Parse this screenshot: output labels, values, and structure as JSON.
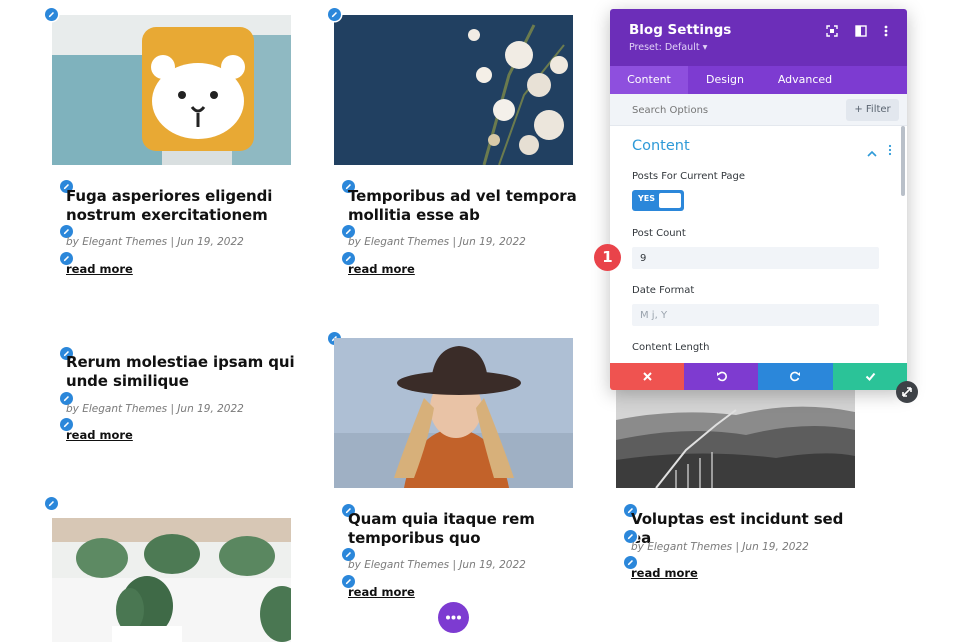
{
  "posts": [
    {
      "title": "Fuga asperiores eligendi nostrum exercitationem",
      "meta": "by Elegant Themes | Jun 19, 2022",
      "read_more": "read more"
    },
    {
      "title": "Temporibus ad vel tempora mollitia esse ab",
      "meta": "by Elegant Themes | Jun 19, 2022",
      "read_more": "read more"
    },
    {
      "title": "Rerum molestiae ipsam qui unde similique",
      "meta": "by Elegant Themes | Jun 19, 2022",
      "read_more": "read more"
    },
    {
      "title": "Quam quia itaque rem temporibus quo",
      "meta": "by Elegant Themes | Jun 19, 2022",
      "read_more": "read more"
    },
    {
      "title": "Voluptas est incidunt sed ea",
      "meta": "by Elegant Themes | Jun 19, 2022",
      "read_more": "read more"
    }
  ],
  "settings_panel": {
    "title": "Blog Settings",
    "preset": "Preset: Default ▾",
    "tabs": [
      {
        "label": "Content"
      },
      {
        "label": "Design"
      },
      {
        "label": "Advanced"
      }
    ],
    "active_tab": "Content",
    "search_placeholder": "Search Options",
    "filter_label": "+ Filter",
    "section_title": "Content",
    "posts_for_current_page_label": "Posts For Current Page",
    "toggle_value": "YES",
    "post_count_label": "Post Count",
    "post_count_value": "9",
    "date_format_label": "Date Format",
    "date_format_placeholder": "M j, Y",
    "content_length_label": "Content Length"
  },
  "step_marker": "1",
  "icons": {
    "head_icons": [
      "expand-icon",
      "split-view-icon",
      "kebab-menu-icon"
    ],
    "footer_icons": [
      "close-icon",
      "undo-icon",
      "redo-icon",
      "check-icon"
    ],
    "edit_icon": "pencil-icon"
  },
  "colors": {
    "panel_header": "#6c2eb9",
    "tabs_bar": "#7d3bd1",
    "accent_blue": "#2b87da",
    "cancel": "#ef5350",
    "undo": "#7e3bd0",
    "redo": "#2b87da",
    "save": "#2bc398",
    "step_badge": "#e9434a"
  }
}
